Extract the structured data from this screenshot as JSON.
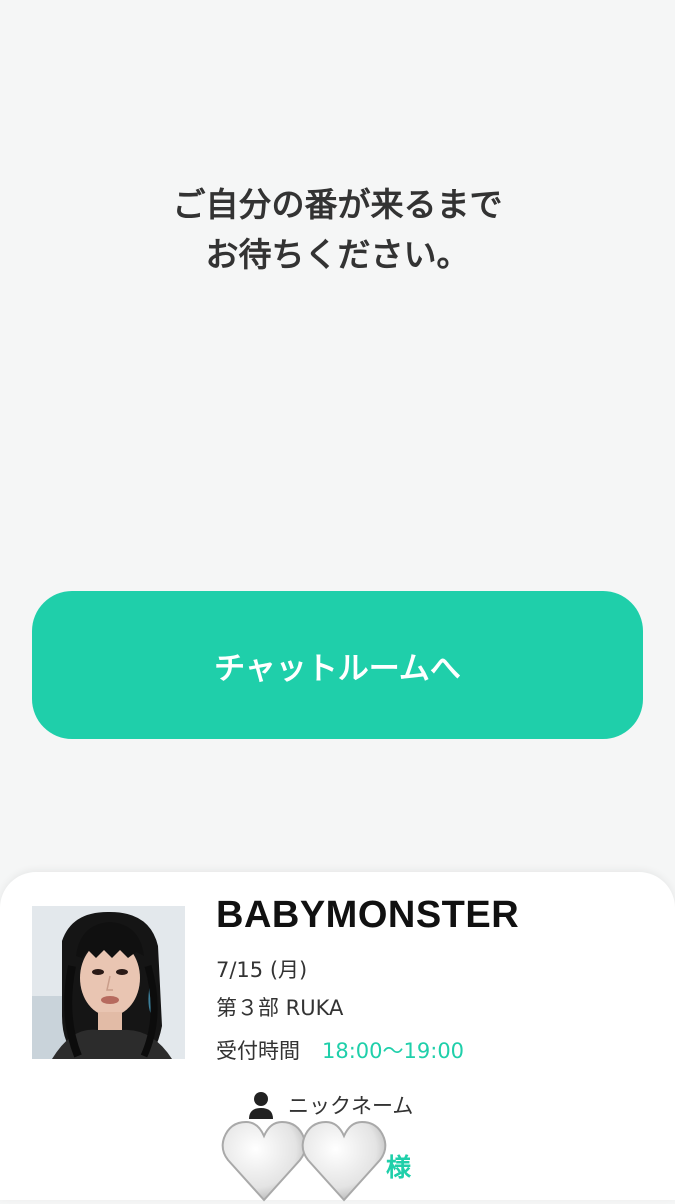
{
  "wait_message": {
    "line1": "ご自分の番が来るまで",
    "line2": "お待ちください。"
  },
  "chat_button": {
    "label": "チャットルームへ"
  },
  "event": {
    "group_name": "BABYMONSTER",
    "date": "7/15 (月)",
    "part": "第３部 RUKA",
    "reception_label": "受付時間",
    "reception_time": "18:00～19:00",
    "nickname_label": "ニックネーム",
    "honorific": "様"
  },
  "colors": {
    "accent": "#1fcfaa",
    "background": "#f5f6f6",
    "text": "#333333"
  },
  "icons": {
    "user": "person-icon",
    "hearts": "white-heart-emoji"
  }
}
